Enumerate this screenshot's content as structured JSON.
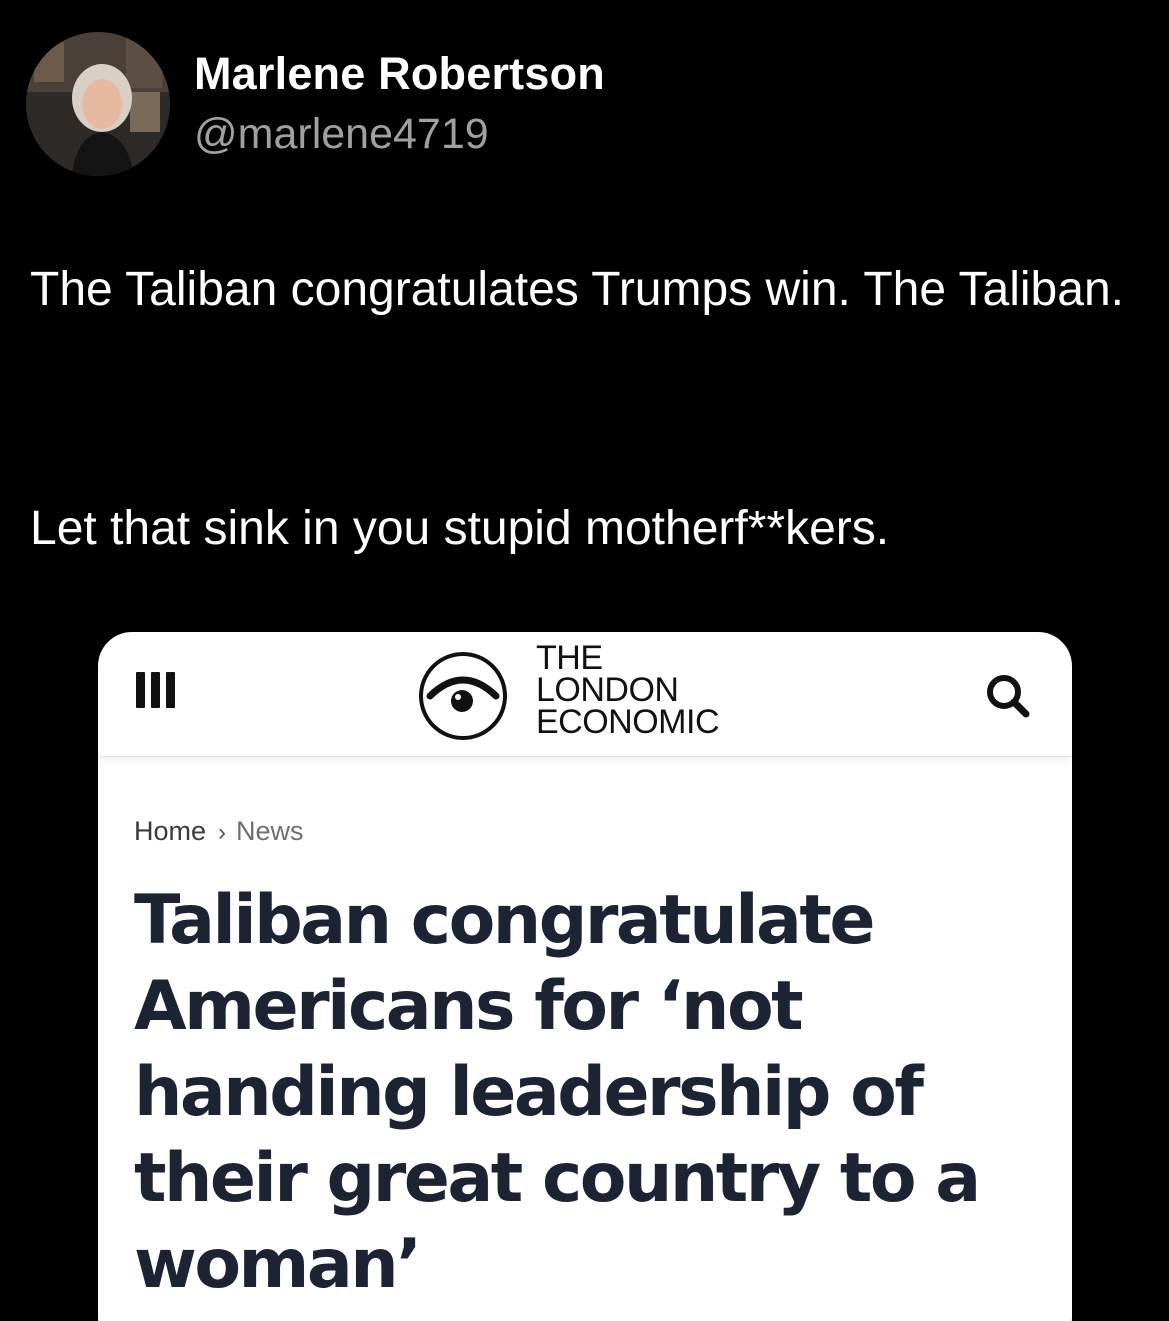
{
  "post": {
    "author": {
      "display_name": "Marlene Robertson",
      "handle": "@marlene4719"
    },
    "text_paragraphs": [
      "The Taliban congratulates Trumps win.  The Taliban.",
      "Let that sink in you stupid motherf**kers."
    ]
  },
  "embedded_article": {
    "site": {
      "logo_lines": [
        "THE",
        "LONDON",
        "ECONOMIC"
      ],
      "logo_icon": "eye-icon",
      "menu_icon": "hamburger-menu-icon",
      "search_icon": "search-icon"
    },
    "breadcrumb": {
      "home": "Home",
      "separator": "›",
      "section": "News"
    },
    "headline": "Taliban congratulate Americans for ‘not handing leadership of their great country to a woman’"
  },
  "colors": {
    "background": "#000000",
    "post_text": "#ffffff",
    "handle_text": "#a0a0a0",
    "card_background": "#ffffff",
    "headline_text": "#1c2333"
  }
}
